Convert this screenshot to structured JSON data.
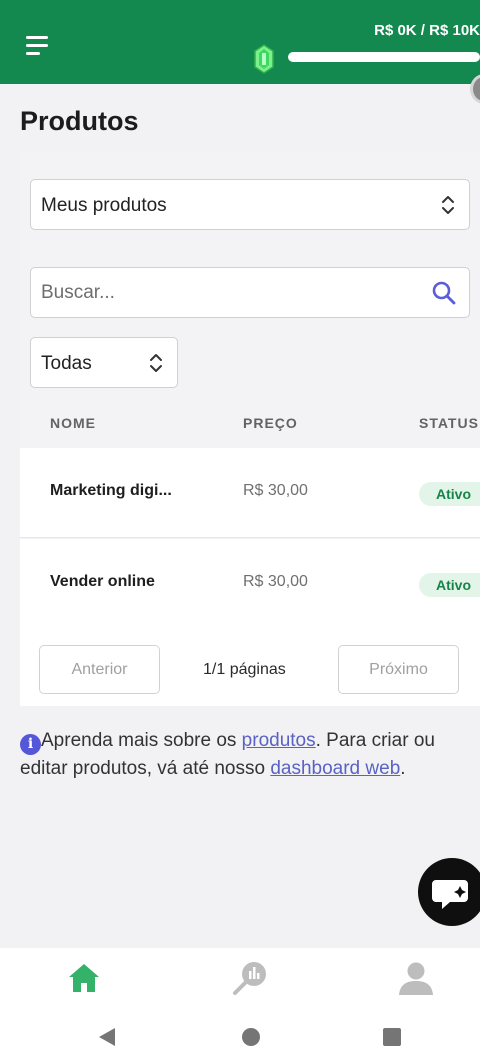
{
  "header": {
    "goal_text": "R$ 0K / R$ 10K",
    "goal_progress_fraction": 0.0,
    "brand_color": "#13884f"
  },
  "page": {
    "title": "Produtos"
  },
  "product_select": {
    "value": "Meus produtos"
  },
  "search": {
    "placeholder": "Buscar..."
  },
  "status_filter": {
    "value": "Todas"
  },
  "table": {
    "columns": [
      "NOME",
      "PREÇO",
      "STATUS"
    ],
    "rows": [
      {
        "name": "Marketing digi...",
        "price": "R$ 30,00",
        "status": "Ativo"
      },
      {
        "name": "Vender online",
        "price": "R$ 30,00",
        "status": "Ativo"
      }
    ]
  },
  "pagination": {
    "prev": "Anterior",
    "info": "1/1 páginas",
    "next": "Próximo"
  },
  "info": {
    "part1": "Aprenda mais sobre os ",
    "link1": "produtos",
    "part2": ". Para criar ou editar produtos, vá até nosso ",
    "link2": "dashboard web",
    "part3": "."
  },
  "bottom_nav": {
    "items": [
      {
        "icon": "home-icon",
        "active": true
      },
      {
        "icon": "search-analytics-icon",
        "active": false
      },
      {
        "icon": "profile-icon",
        "active": false
      }
    ],
    "active_color": "#34b26a"
  }
}
